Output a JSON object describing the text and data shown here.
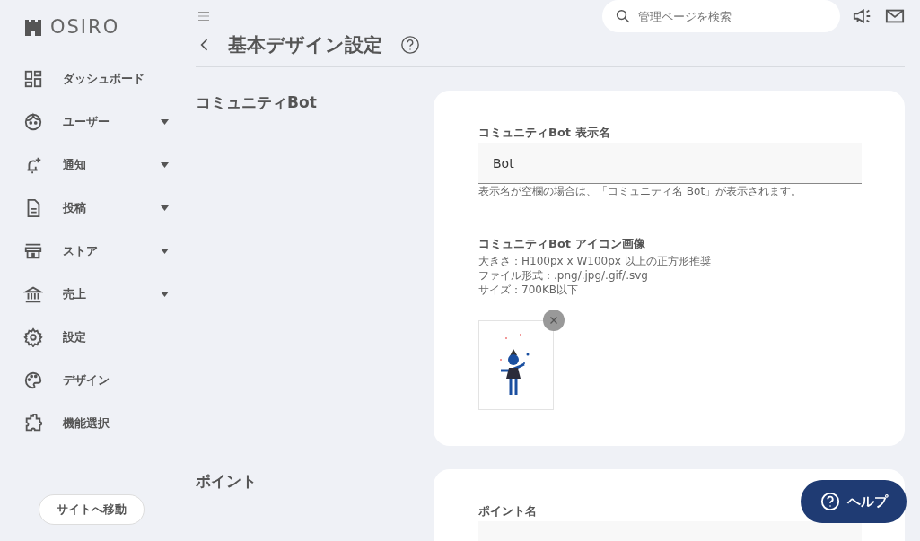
{
  "brand": {
    "name": "OSIRO"
  },
  "sidebar": {
    "items": [
      {
        "label": "ダッシュボード",
        "has_submenu": false
      },
      {
        "label": "ユーザー",
        "has_submenu": true
      },
      {
        "label": "通知",
        "has_submenu": true
      },
      {
        "label": "投稿",
        "has_submenu": true
      },
      {
        "label": "ストア",
        "has_submenu": true
      },
      {
        "label": "売上",
        "has_submenu": true
      },
      {
        "label": "設定",
        "has_submenu": false
      },
      {
        "label": "デザイン",
        "has_submenu": false
      },
      {
        "label": "機能選択",
        "has_submenu": false
      }
    ],
    "site_button": "サイトへ移動"
  },
  "search": {
    "placeholder": "管理ページを検索"
  },
  "page_title": "基本デザイン設定",
  "sections": [
    {
      "title": "コミュニティBot",
      "fields": [
        {
          "kind": "text",
          "label": "コミュニティBot 表示名",
          "value": "Bot",
          "hint": "表示名が空欄の場合は、「コミュニティ名 Bot」が表示されます。"
        },
        {
          "kind": "image",
          "label": "コミュニティBot アイコン画像",
          "notes": [
            "大きさ：H100px x W100px 以上の正方形推奨",
            "ファイル形式：.png/.jpg/.gif/.svg",
            "サイズ：700KB以下"
          ]
        }
      ]
    },
    {
      "title": "ポイント",
      "fields": [
        {
          "kind": "text",
          "label": "ポイント名"
        }
      ]
    }
  ],
  "help_button": "ヘルプ"
}
